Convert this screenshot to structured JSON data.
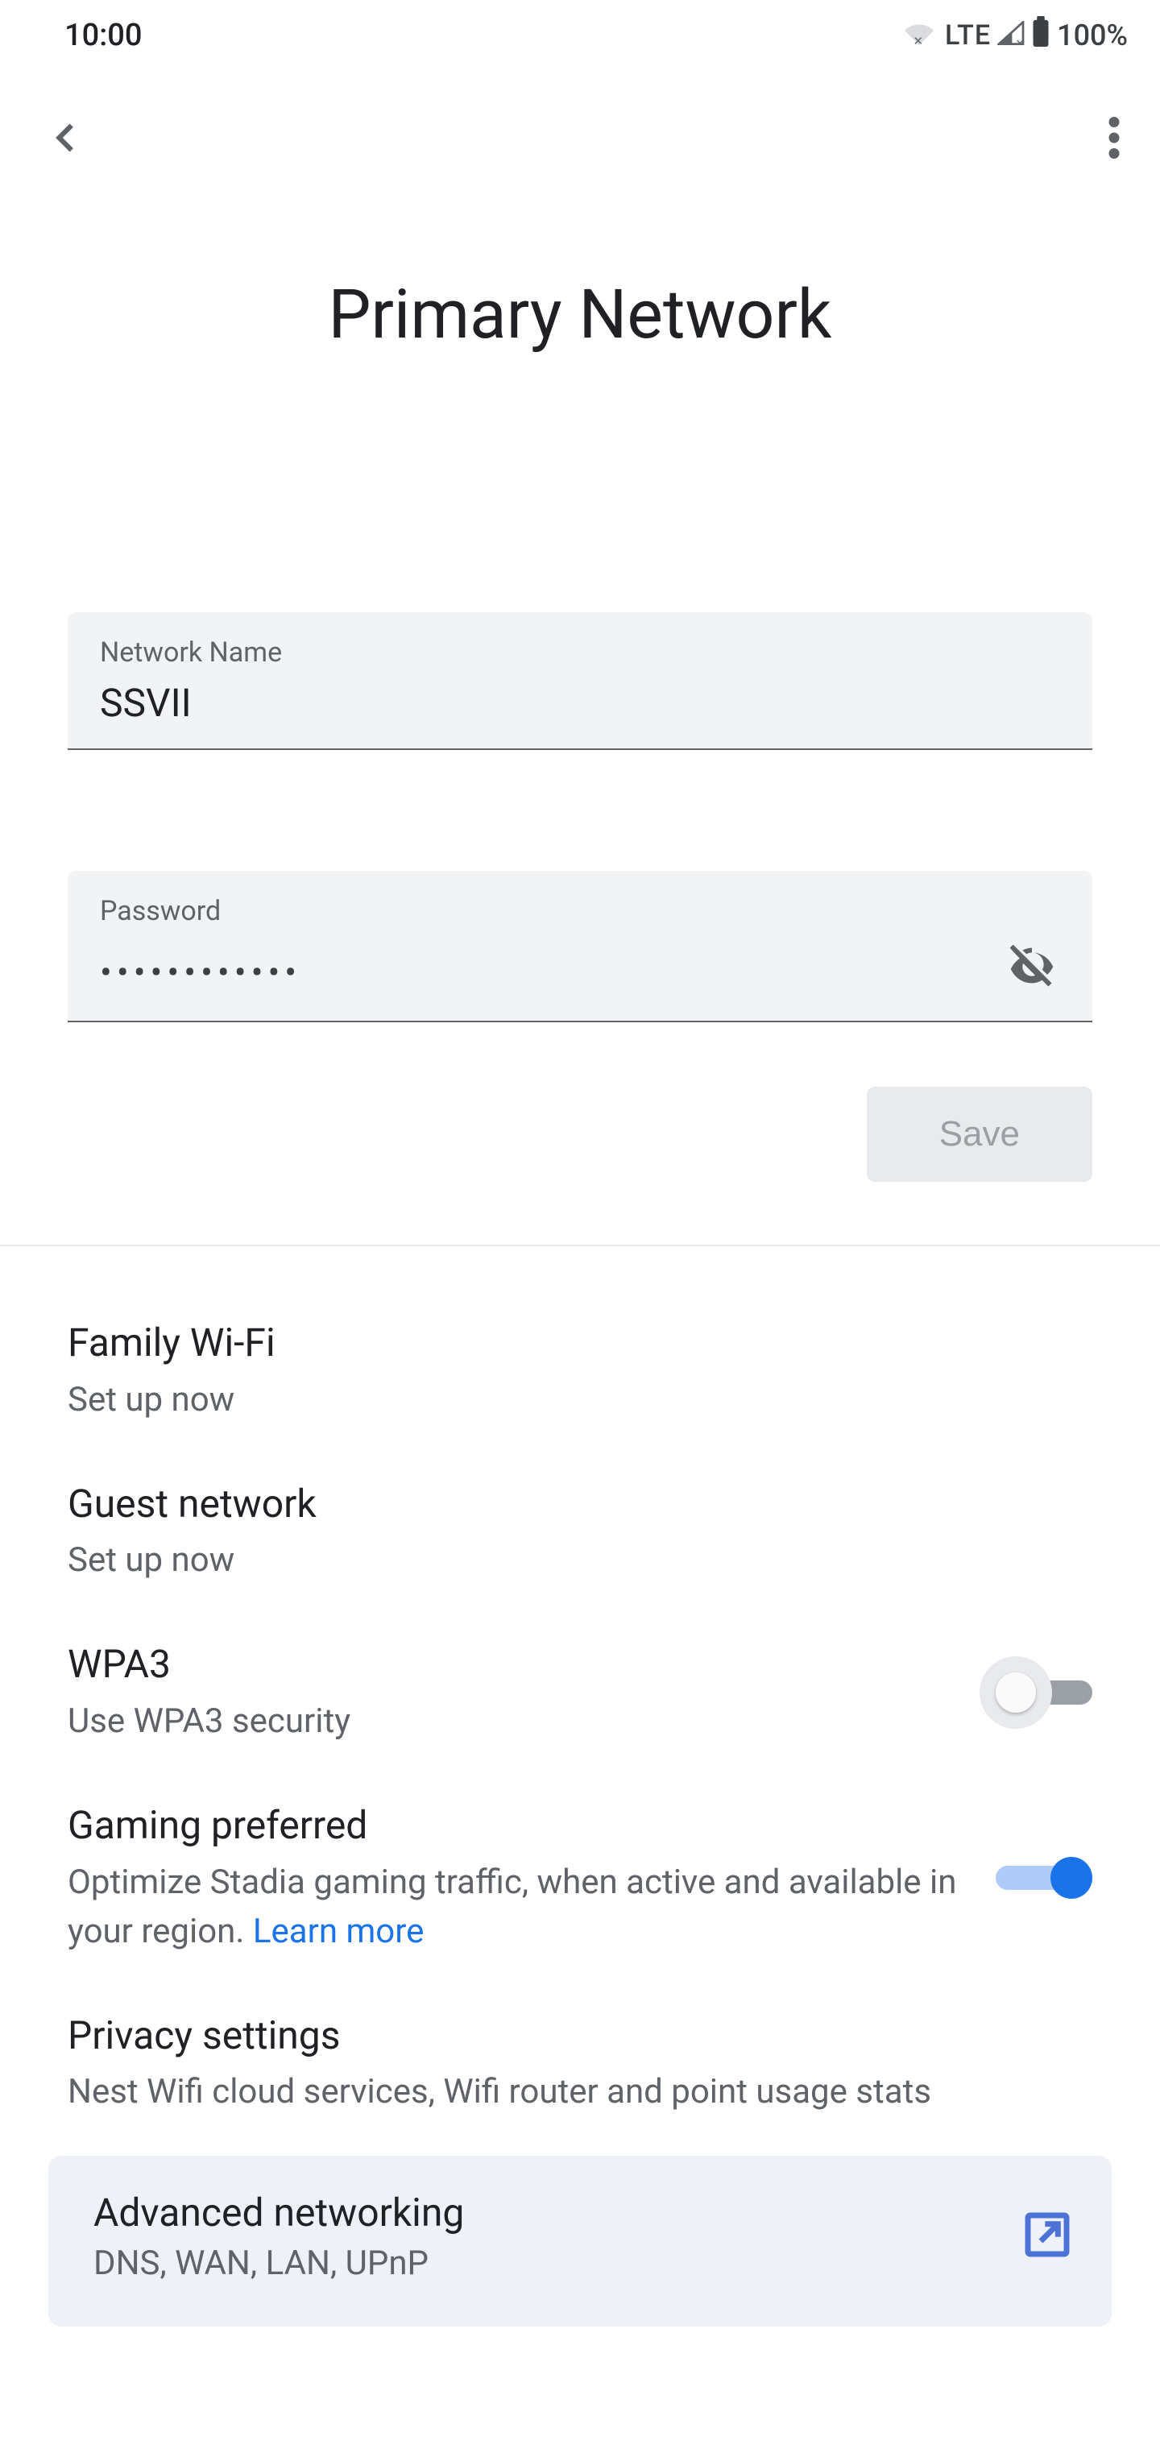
{
  "status": {
    "time": "10:00",
    "lte": "LTE",
    "battery": "100%"
  },
  "header": {
    "title": "Primary Network"
  },
  "fields": {
    "name_label": "Network Name",
    "name_value": "SSVII",
    "password_label": "Password",
    "password_value": "••••••••••••"
  },
  "buttons": {
    "save": "Save"
  },
  "items": {
    "family": {
      "title": "Family Wi-Fi",
      "sub": "Set up now"
    },
    "guest": {
      "title": "Guest network",
      "sub": "Set up now"
    },
    "wpa3": {
      "title": "WPA3",
      "sub": "Use WPA3 security"
    },
    "gaming": {
      "title": "Gaming preferred",
      "sub": "Optimize Stadia gaming traffic, when active and available in your region. ",
      "learn": "Learn more"
    },
    "privacy": {
      "title": "Privacy settings",
      "sub": "Nest Wifi cloud services, Wifi router and point usage stats"
    },
    "advanced": {
      "title": "Advanced networking",
      "sub": "DNS, WAN, LAN, UPnP"
    }
  }
}
